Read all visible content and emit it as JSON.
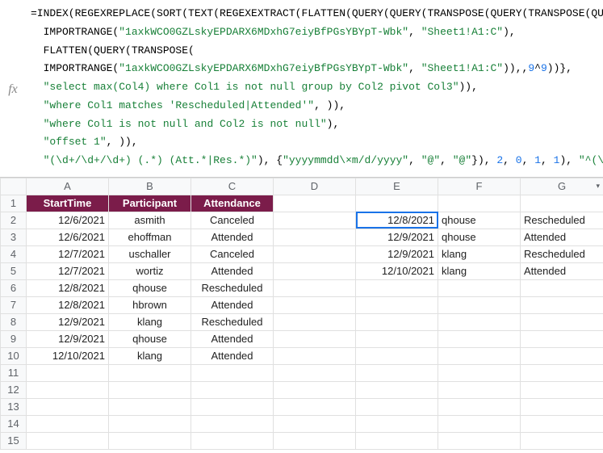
{
  "formula": {
    "segments": [
      {
        "c": "",
        "t": "=INDEX(REGEXREPLACE(SORT(TEXT(REGEXEXTRACT(FLATTEN(QUERY(QUERY(TRANSPOSE(QUERY(TRANSPOSE(QUERY({"
      },
      {
        "c": "",
        "t": "\n  IMPORTRANGE("
      },
      {
        "c": "g",
        "t": "\"1axkWCO0GZLskyEPDARX6MDxhG7eiyBfPGsYBYpT-Wbk\""
      },
      {
        "c": "",
        "t": ", "
      },
      {
        "c": "g",
        "t": "\"Sheet1!A1:C\""
      },
      {
        "c": "",
        "t": "),"
      },
      {
        "c": "",
        "t": "\n  FLATTEN(QUERY(TRANSPOSE("
      },
      {
        "c": "",
        "t": "\n  IMPORTRANGE("
      },
      {
        "c": "g",
        "t": "\"1axkWCO0GZLskyEPDARX6MDxhG7eiyBfPGsYBYpT-Wbk\""
      },
      {
        "c": "",
        "t": ", "
      },
      {
        "c": "g",
        "t": "\"Sheet1!A1:C\""
      },
      {
        "c": "",
        "t": ")),,"
      },
      {
        "c": "b",
        "t": "9"
      },
      {
        "c": "",
        "t": "^"
      },
      {
        "c": "b",
        "t": "9"
      },
      {
        "c": "",
        "t": "))},"
      },
      {
        "c": "",
        "t": "\n  "
      },
      {
        "c": "g",
        "t": "\"select max(Col4) where Col1 is not null group by Col2 pivot Col3\""
      },
      {
        "c": "",
        "t": ")),"
      },
      {
        "c": "",
        "t": "\n  "
      },
      {
        "c": "g",
        "t": "\"where Col1 matches 'Rescheduled|Attended'\""
      },
      {
        "c": "",
        "t": ", )),"
      },
      {
        "c": "",
        "t": "\n  "
      },
      {
        "c": "g",
        "t": "\"where Col1 is not null and Col2 is not null\""
      },
      {
        "c": "",
        "t": "),"
      },
      {
        "c": "",
        "t": "\n  "
      },
      {
        "c": "g",
        "t": "\"offset 1\""
      },
      {
        "c": "",
        "t": ", )),"
      },
      {
        "c": "",
        "t": "\n  "
      },
      {
        "c": "g",
        "t": "\"(\\d+/\\d+/\\d+) (.*) (Att.*|Res.*)\""
      },
      {
        "c": "",
        "t": "), {"
      },
      {
        "c": "g",
        "t": "\"yyyymmdd\\×m/d/yyyy\""
      },
      {
        "c": "",
        "t": ", "
      },
      {
        "c": "g",
        "t": "\"@\""
      },
      {
        "c": "",
        "t": ", "
      },
      {
        "c": "g",
        "t": "\"@\""
      },
      {
        "c": "",
        "t": "}), "
      },
      {
        "c": "b",
        "t": "2"
      },
      {
        "c": "",
        "t": ", "
      },
      {
        "c": "b",
        "t": "0"
      },
      {
        "c": "",
        "t": ", "
      },
      {
        "c": "b",
        "t": "1"
      },
      {
        "c": "",
        "t": ", "
      },
      {
        "c": "b",
        "t": "1"
      },
      {
        "c": "",
        "t": "), "
      },
      {
        "c": "g",
        "t": "\"^(\\d+×)\""
      },
      {
        "c": "",
        "t": ", ))"
      }
    ]
  },
  "fx_label": "fx",
  "columns": [
    "A",
    "B",
    "C",
    "D",
    "E",
    "F",
    "G"
  ],
  "row_numbers": [
    "1",
    "2",
    "3",
    "4",
    "5",
    "6",
    "7",
    "8",
    "9",
    "10",
    "11",
    "12",
    "13",
    "14",
    "15"
  ],
  "headers": {
    "a": "StartTime",
    "b": "Participant",
    "c": "Attendance"
  },
  "left": [
    {
      "date": "12/6/2021",
      "name": "asmith",
      "att": "Canceled"
    },
    {
      "date": "12/6/2021",
      "name": "ehoffman",
      "att": "Attended"
    },
    {
      "date": "12/7/2021",
      "name": "uschaller",
      "att": "Canceled"
    },
    {
      "date": "12/7/2021",
      "name": "wortiz",
      "att": "Attended"
    },
    {
      "date": "12/8/2021",
      "name": "qhouse",
      "att": "Rescheduled"
    },
    {
      "date": "12/8/2021",
      "name": "hbrown",
      "att": "Attended"
    },
    {
      "date": "12/9/2021",
      "name": "klang",
      "att": "Rescheduled"
    },
    {
      "date": "12/9/2021",
      "name": "qhouse",
      "att": "Attended"
    },
    {
      "date": "12/10/2021",
      "name": "klang",
      "att": "Attended"
    }
  ],
  "right": [
    {
      "date": "12/8/2021",
      "name": "qhouse",
      "att": "Rescheduled"
    },
    {
      "date": "12/9/2021",
      "name": "qhouse",
      "att": "Attended"
    },
    {
      "date": "12/9/2021",
      "name": "klang",
      "att": "Rescheduled"
    },
    {
      "date": "12/10/2021",
      "name": "klang",
      "att": "Attended"
    }
  ],
  "selected_cell": "E2",
  "dropdown_glyph": "▾"
}
